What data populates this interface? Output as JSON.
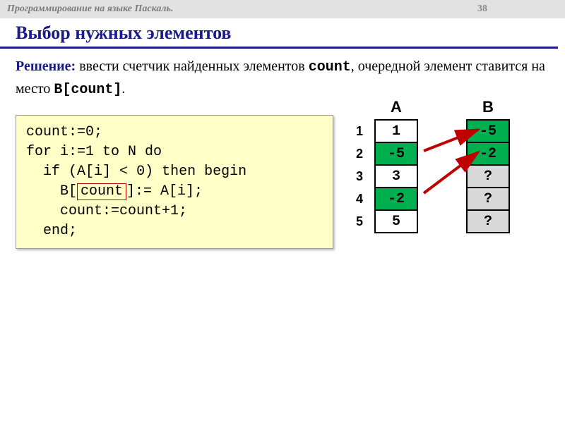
{
  "header": {
    "title": "Программирование на языке Паскаль.",
    "page": "38"
  },
  "title": "Выбор нужных элементов",
  "solution": {
    "label": "Решение:",
    "part1": " ввести счетчик найденных элементов ",
    "code1": "count",
    "part2": ", очередной элемент ставится на место ",
    "code2": "B[count]",
    "part3": "."
  },
  "code": {
    "l1": "count:=0;",
    "l2": "for i:=1 to N do",
    "l3a": "  if (A[i]",
    "l3b": "<",
    "l3c": "0) then begin",
    "l4a": "    B[",
    "l4b": "count",
    "l4c": "]:= A[i];",
    "l5": "    count:=count+1;",
    "l6": "  end;"
  },
  "tables": {
    "labelA": "A",
    "labelB": "B",
    "indices": [
      "1",
      "2",
      "3",
      "4",
      "5"
    ],
    "A": [
      {
        "v": "1",
        "cls": ""
      },
      {
        "v": "-5",
        "cls": "green"
      },
      {
        "v": "3",
        "cls": ""
      },
      {
        "v": "-2",
        "cls": "green"
      },
      {
        "v": "5",
        "cls": ""
      }
    ],
    "B": [
      {
        "v": "-5",
        "cls": "green"
      },
      {
        "v": "-2",
        "cls": "green"
      },
      {
        "v": "?",
        "cls": "gray"
      },
      {
        "v": "?",
        "cls": "gray"
      },
      {
        "v": "?",
        "cls": "gray"
      }
    ]
  }
}
